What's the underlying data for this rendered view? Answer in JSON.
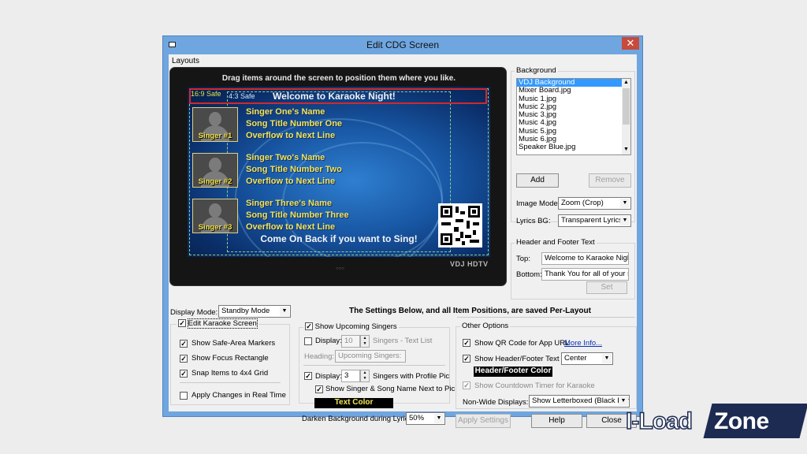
{
  "window": {
    "title": "Edit CDG Screen",
    "close_glyph": "✕"
  },
  "menu": {
    "layouts": "Layouts"
  },
  "tv": {
    "hint": "Drag items around the screen to position them where you like.",
    "safe_169": "16:9 Safe",
    "safe_43": "4:3 Safe",
    "header_text": "Welcome to Karaoke Night!",
    "singers": [
      {
        "label": "Singer #1",
        "lines": [
          "Singer One's Name",
          "Song Title Number One",
          "Overflow to Next Line"
        ]
      },
      {
        "label": "Singer #2",
        "lines": [
          "Singer Two's Name",
          "Song Title Number Two",
          "Overflow to Next Line"
        ]
      },
      {
        "label": "Singer #3",
        "lines": [
          "Singer Three's Name",
          "Song Title Number Three",
          "Overflow to Next Line"
        ]
      }
    ],
    "footer_text": "Come On Back if you want to Sing!",
    "brand": "VDJ HDTV",
    "power_label": "○○○"
  },
  "display_mode": {
    "label": "Display Mode:",
    "value": "Standby Mode"
  },
  "per_layout_note": "The Settings Below, and all Item Positions, are saved Per-Layout",
  "edit_karaoke": {
    "title": "Edit Karaoke Screen",
    "checked": true,
    "options": [
      {
        "label": "Show Safe-Area Markers",
        "checked": true
      },
      {
        "label": "Show Focus Rectangle",
        "checked": true
      },
      {
        "label": "Snap Items to 4x4 Grid",
        "checked": true
      }
    ],
    "realtime": {
      "label": "Apply Changes in Real Time",
      "checked": false
    }
  },
  "upcoming": {
    "title": "Show Upcoming Singers",
    "checked": true,
    "text_list": {
      "label": "Display:",
      "checked": false,
      "count": "10",
      "suffix": "Singers - Text List"
    },
    "heading": {
      "label": "Heading:",
      "value": "Upcoming Singers:"
    },
    "profile": {
      "label": "Display:",
      "checked": true,
      "count": "3",
      "suffix": "Singers with Profile Pic"
    },
    "show_name": {
      "label": "Show Singer & Song Name Next to Pic",
      "checked": true
    },
    "text_color": {
      "label": "Text Color",
      "bg": "#000000",
      "fg": "#f4ea5a"
    },
    "darken": {
      "label": "Darken Background during Lyrics:",
      "value": "50%"
    }
  },
  "other": {
    "title": "Other Options",
    "qr": {
      "label": "Show QR Code for App URL",
      "checked": true,
      "link": "More Info..."
    },
    "header_footer": {
      "label": "Show Header/Footer Text",
      "checked": true,
      "align": "Center"
    },
    "hf_color": {
      "label": "Header/Footer Color",
      "bg": "#000000",
      "fg": "#ffffff"
    },
    "countdown": {
      "label": "Show Countdown Timer for Karaoke",
      "checked": true
    },
    "nonwide": {
      "label": "Non-Wide Displays:",
      "value": "Show Letterboxed (Black Bars)"
    }
  },
  "buttons": {
    "apply": "Apply Settings",
    "help": "Help",
    "close": "Close"
  },
  "background": {
    "title": "Background",
    "items": [
      "VDJ Background",
      "Mixer Board.jpg",
      "Music 1.jpg",
      "Music 2.jpg",
      "Music 3.jpg",
      "Music 4.jpg",
      "Music 5.jpg",
      "Music 6.jpg",
      "Speaker Blue.jpg"
    ],
    "add": "Add",
    "remove": "Remove",
    "image_mode": {
      "label": "Image Mode:",
      "value": "Zoom (Crop)"
    },
    "lyrics_bg": {
      "label": "Lyrics BG:",
      "value": "Transparent Lyrics"
    }
  },
  "header_footer_text": {
    "title": "Header and Footer Text",
    "top": {
      "label": "Top:",
      "value": "Welcome to Karaoke Night!"
    },
    "bottom": {
      "label": "Bottom:",
      "value": "Thank You for all of your support!"
    },
    "set": "Set"
  },
  "watermark": {
    "part1": "I-Load",
    "part2": "Zone"
  }
}
